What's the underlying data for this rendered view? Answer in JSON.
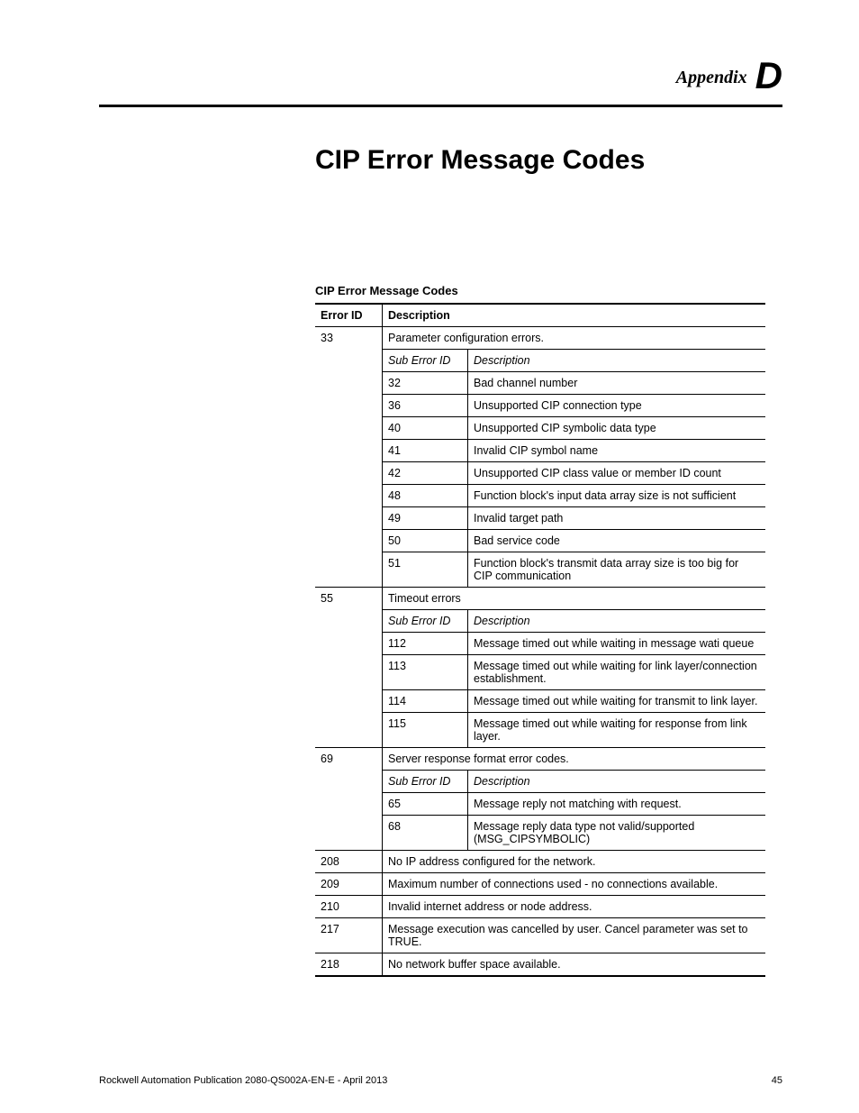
{
  "header": {
    "appendix_label": "Appendix",
    "appendix_letter": "D"
  },
  "title": "CIP Error Message Codes",
  "table": {
    "caption": "CIP Error Message Codes",
    "col_error_id": "Error ID",
    "col_description": "Description",
    "sub_col_id": "Sub Error ID",
    "sub_col_desc": "Description",
    "groups": [
      {
        "id": "33",
        "label": "Parameter configuration errors.",
        "subs": [
          {
            "id": "32",
            "desc": "Bad channel number"
          },
          {
            "id": "36",
            "desc": "Unsupported CIP connection type"
          },
          {
            "id": "40",
            "desc": "Unsupported CIP symbolic data type"
          },
          {
            "id": "41",
            "desc": "Invalid CIP symbol name"
          },
          {
            "id": "42",
            "desc": "Unsupported CIP class value or member ID count"
          },
          {
            "id": "48",
            "desc": "Function block's input data array size is not sufficient"
          },
          {
            "id": "49",
            "desc": "Invalid target path"
          },
          {
            "id": "50",
            "desc": "Bad service code"
          },
          {
            "id": "51",
            "desc": "Function block's transmit data array size is too big for CIP communication"
          }
        ]
      },
      {
        "id": "55",
        "label": "Timeout errors",
        "subs": [
          {
            "id": "112",
            "desc": "Message timed out while waiting in message wati queue"
          },
          {
            "id": "113",
            "desc": "Message timed out while waiting for link layer/connection establishment."
          },
          {
            "id": "114",
            "desc": "Message timed out while waiting for transmit to link layer."
          },
          {
            "id": "115",
            "desc": "Message timed out while waiting for response from link layer."
          }
        ]
      },
      {
        "id": "69",
        "label": "Server response format error codes.",
        "subs": [
          {
            "id": "65",
            "desc": "Message reply not matching with request."
          },
          {
            "id": "68",
            "desc": "Message reply data type not valid/supported (MSG_CIPSYMBOLIC)"
          }
        ]
      }
    ],
    "simple_rows": [
      {
        "id": "208",
        "desc": "No IP address configured for the network."
      },
      {
        "id": "209",
        "desc": "Maximum number of connections used - no connections available."
      },
      {
        "id": "210",
        "desc": "Invalid internet address or node address."
      },
      {
        "id": "217",
        "desc": "Message execution was cancelled by user. Cancel parameter was set to TRUE."
      },
      {
        "id": "218",
        "desc": "No network buffer space available."
      }
    ]
  },
  "footer": {
    "pub": "Rockwell Automation Publication 2080-QS002A-EN-E - April 2013",
    "page": "45"
  }
}
